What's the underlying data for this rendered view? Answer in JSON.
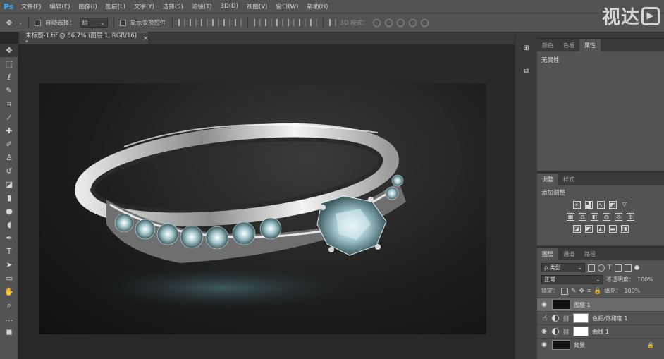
{
  "app": {
    "logo": "Ps"
  },
  "menu": [
    "文件(F)",
    "编辑(E)",
    "图像(I)",
    "图层(L)",
    "文字(Y)",
    "选择(S)",
    "滤镜(T)",
    "3D(D)",
    "视图(V)",
    "窗口(W)",
    "帮助(H)"
  ],
  "options": {
    "auto_select_label": "自动选择：",
    "auto_select_value": "组",
    "show_transform_label": "显示变换控件",
    "mode_3d_label": "3D 模式："
  },
  "watermark": "视达",
  "document": {
    "tab_title": "未标题-1.tif @ 66.7% (图层 1, RGB/16) *",
    "close": "×"
  },
  "panels": {
    "top_tabs": [
      "颜色",
      "色板",
      "属性"
    ],
    "properties_text": "无属性",
    "mid_tabs": [
      "调整",
      "样式"
    ],
    "adjust_title": "添加调整",
    "layer_tabs": [
      "图层",
      "通道",
      "路径"
    ],
    "layer_filter": "ρ 类型",
    "blend_mode": "正常",
    "opacity_label": "不透明度：",
    "opacity_value": "100%",
    "lock_label": "锁定：",
    "fill_label": "填充：",
    "fill_value": "100%",
    "layers": [
      {
        "name": "图层 1",
        "kind": "pixel",
        "selected": true
      },
      {
        "name": "色相/饱和度 1",
        "kind": "adjust",
        "selected": false
      },
      {
        "name": "曲线 1",
        "kind": "adjust",
        "selected": false
      },
      {
        "name": "背景",
        "kind": "pixel",
        "selected": false
      }
    ]
  }
}
